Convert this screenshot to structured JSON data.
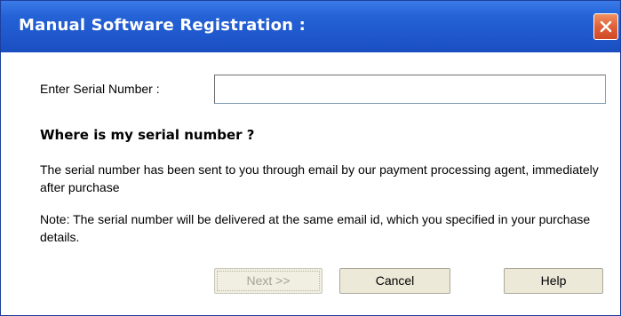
{
  "window": {
    "title": "Manual Software Registration :"
  },
  "form": {
    "serial_label": "Enter Serial Number :",
    "serial_value": "",
    "heading": "Where is my serial number ?",
    "paragraph1": "The serial number has been sent to you through email by our payment processing agent, immediately after purchase",
    "paragraph2": "Note: The serial number will be delivered at the same email id, which you specified in your purchase details."
  },
  "buttons": {
    "next_label": "Next >>",
    "next_enabled": false,
    "cancel_label": "Cancel",
    "help_label": "Help"
  },
  "colors": {
    "titlebar": "#2462d6",
    "close_button": "#e0603a",
    "button_face": "#ece9d8",
    "disabled_text": "#a6a394"
  },
  "icons": {
    "close": "close-icon"
  }
}
